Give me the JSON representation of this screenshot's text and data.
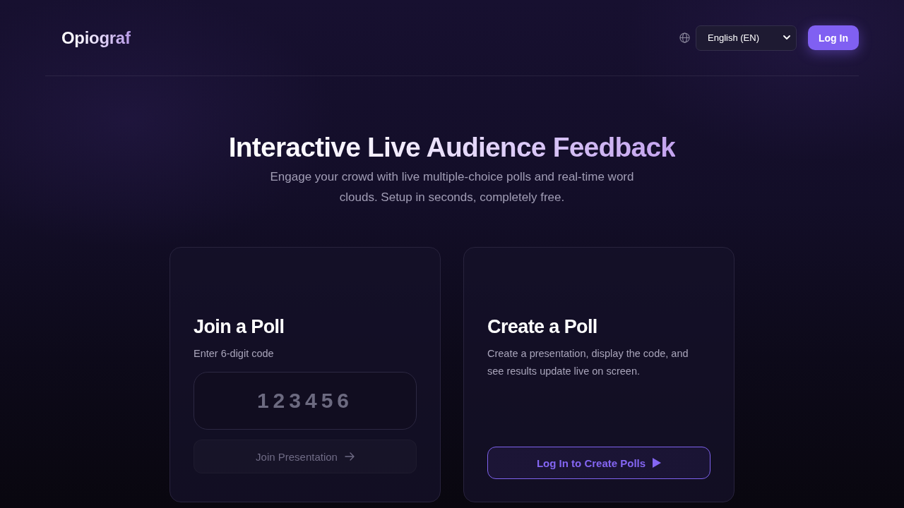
{
  "header": {
    "logo": "Opiograf",
    "language_select": {
      "value": "English (EN)"
    },
    "login_button": "Log In"
  },
  "hero": {
    "title": "Interactive Live Audience Feedback",
    "subtitle": "Engage your crowd with live multiple-choice polls and real-time word clouds. Setup in seconds, completely free."
  },
  "cards": [
    {
      "kind": "join",
      "title": "Join a Poll",
      "description": "Enter 6-digit code",
      "code_field": {
        "placeholder": "123456"
      },
      "button": {
        "label": "Join Presentation",
        "disabled": true
      }
    },
    {
      "kind": "create",
      "title": "Create a Poll",
      "description": "Create a presentation, display the code, and see results update live on screen.",
      "button": {
        "label": "Log In to Create Polls",
        "disabled": false
      }
    }
  ]
}
